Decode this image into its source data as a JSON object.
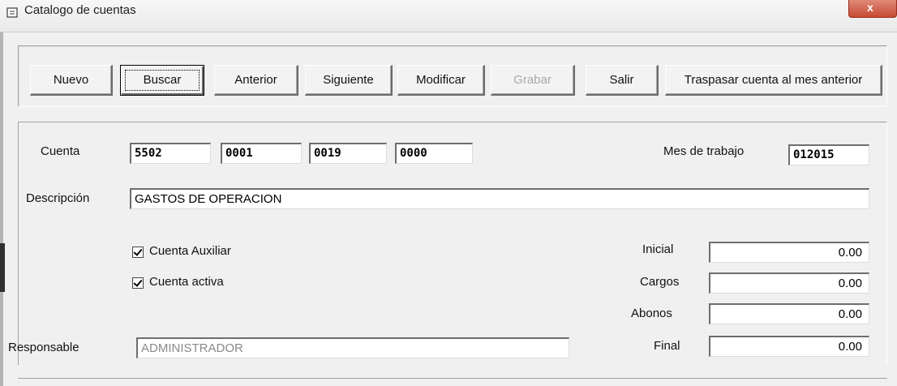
{
  "window": {
    "title": "Catalogo de cuentas",
    "close_label": "x"
  },
  "toolbar": {
    "buttons": [
      {
        "label": "Nuevo"
      },
      {
        "label": "Buscar"
      },
      {
        "label": "Anterior"
      },
      {
        "label": "Siguiente"
      },
      {
        "label": "Modificar"
      },
      {
        "label": "Grabar"
      },
      {
        "label": "Salir"
      },
      {
        "label": "Traspasar cuenta al mes anterior"
      }
    ]
  },
  "form": {
    "cuenta_label": "Cuenta",
    "cuenta": [
      "5502",
      "0001",
      "0019",
      "0000"
    ],
    "mes_label": "Mes de trabajo",
    "mes_value": "012015",
    "descripcion_label": "Descripción",
    "descripcion_value": "GASTOS DE OPERACION",
    "auxiliar_label": "Cuenta Auxiliar",
    "activa_label": "Cuenta activa",
    "responsable_label": "Responsable",
    "responsable_value": "ADMINISTRADOR",
    "balances": [
      {
        "label": "Inicial",
        "value": "0.00"
      },
      {
        "label": "Cargos",
        "value": "0.00"
      },
      {
        "label": "Abonos",
        "value": "0.00"
      },
      {
        "label": "Final",
        "value": "0.00"
      }
    ]
  }
}
